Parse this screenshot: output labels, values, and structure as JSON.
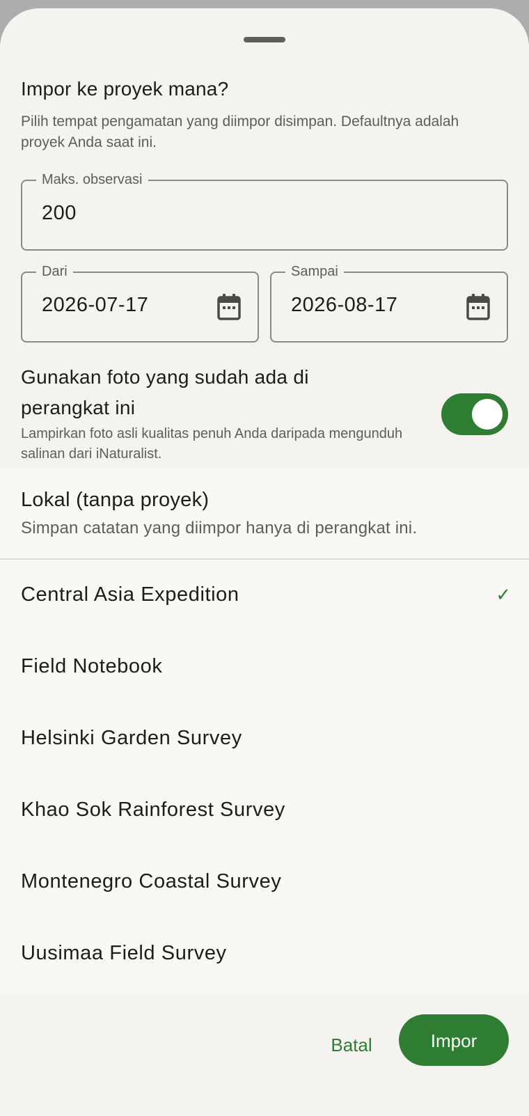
{
  "sheet": {
    "title": "Impor ke proyek mana?",
    "subtitle": "Pilih tempat pengamatan yang diimpor disimpan. Defaultnya adalah proyek Anda saat ini."
  },
  "max_obs": {
    "label": "Maks. observasi",
    "value": "200"
  },
  "date_from": {
    "label": "Dari",
    "value": "2026-07-17",
    "icon": "calendar-icon"
  },
  "date_to": {
    "label": "Sampai",
    "value": "2026-08-17",
    "icon": "calendar-icon"
  },
  "photos_toggle": {
    "title": "Gunakan foto yang sudah ada di perangkat ini",
    "description": "Lampirkan foto asli kualitas penuh Anda daripada mengunduh salinan dari iNaturalist.",
    "on": true
  },
  "local_option": {
    "title": "Lokal (tanpa proyek)",
    "description": "Simpan catatan yang diimpor hanya di perangkat ini."
  },
  "projects": [
    {
      "label": "Central Asia Expedition",
      "check": "✓",
      "selected": true
    },
    {
      "label": "Field Notebook",
      "check": "",
      "selected": false
    },
    {
      "label": "Helsinki Garden Survey",
      "check": "",
      "selected": false
    },
    {
      "label": "Khao Sok Rainforest Survey",
      "check": "",
      "selected": false
    },
    {
      "label": "Montenegro Coastal Survey",
      "check": "",
      "selected": false
    },
    {
      "label": "Uusimaa Field Survey",
      "check": "",
      "selected": false
    }
  ],
  "footer": {
    "cancel_label": "Batal",
    "import_label": "Impor"
  },
  "colors": {
    "accent": "#2e7d32",
    "sheet_bg": "#f4f3ef",
    "list_bg": "#f9f8f4",
    "scrim": "#adadad"
  }
}
